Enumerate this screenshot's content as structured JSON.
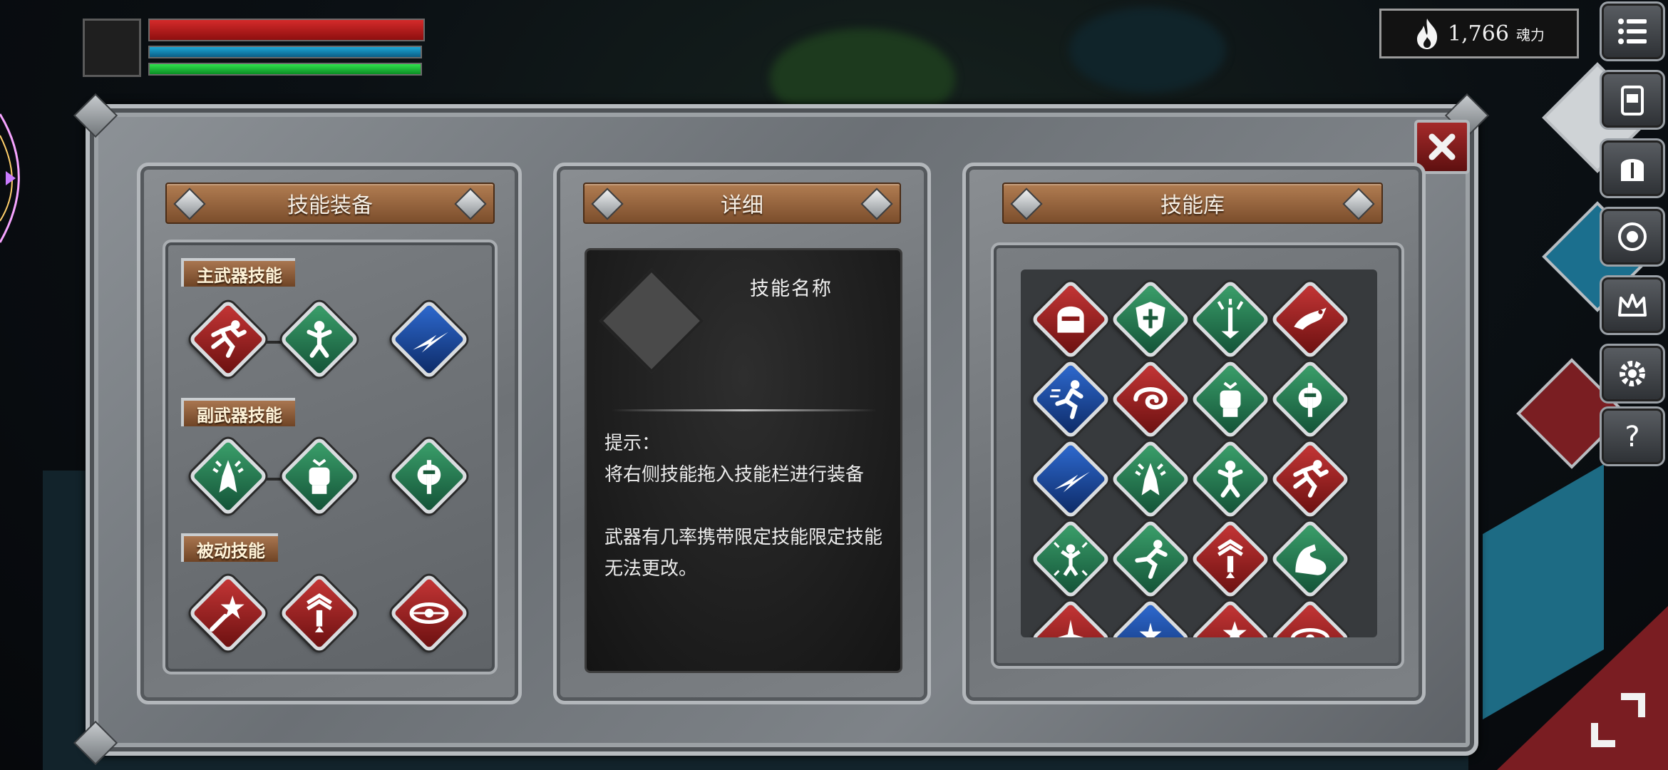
{
  "hud": {
    "hp_fraction": 1.0,
    "mp_fraction": 1.0,
    "stamina_fraction": 1.0,
    "souls_value": "1,766",
    "souls_unit": "魂力"
  },
  "panels": {
    "equip_title": "技能装备",
    "detail_title": "详细",
    "library_title": "技能库"
  },
  "equip": {
    "main_label": "主武器技能",
    "sub_label": "副武器技能",
    "passive_label": "被动技能",
    "main_skills": [
      {
        "color": "red",
        "icon": "dash-runner-icon"
      },
      {
        "color": "green",
        "icon": "fighter-stance-icon"
      },
      {
        "color": "blue",
        "icon": "lightning-slash-icon"
      }
    ],
    "sub_skills": [
      {
        "color": "green",
        "icon": "praying-hands-icon"
      },
      {
        "color": "green",
        "icon": "fist-icon"
      },
      {
        "color": "green",
        "icon": "holy-axe-icon"
      }
    ],
    "passive_skills": [
      {
        "color": "red",
        "icon": "star-sword-icon"
      },
      {
        "color": "red",
        "icon": "rank-sword-icon"
      },
      {
        "color": "red",
        "icon": "eye-dagger-icon"
      }
    ]
  },
  "detail": {
    "skill_name": "技能名称",
    "hint_title": "提示：",
    "hint_line1": "将右侧技能拖入技能栏进行装备",
    "hint_line2": "武器有几率携带限定技能限定技能无法更改。"
  },
  "library": {
    "skills": [
      {
        "color": "red",
        "icon": "helmet-icon"
      },
      {
        "color": "green",
        "icon": "shield-cross-icon"
      },
      {
        "color": "green",
        "icon": "sword-burst-icon"
      },
      {
        "color": "red",
        "icon": "dragon-icon"
      },
      {
        "color": "blue",
        "icon": "sprint-icon"
      },
      {
        "color": "red",
        "icon": "swirl-icon"
      },
      {
        "color": "green",
        "icon": "fist-icon"
      },
      {
        "color": "green",
        "icon": "holy-axe-icon"
      },
      {
        "color": "blue",
        "icon": "lightning-slash-icon"
      },
      {
        "color": "green",
        "icon": "praying-hands-icon"
      },
      {
        "color": "green",
        "icon": "fighter-stance-icon"
      },
      {
        "color": "red",
        "icon": "dash-runner-icon"
      },
      {
        "color": "green",
        "icon": "burst-figure-icon"
      },
      {
        "color": "green",
        "icon": "runner-icon"
      },
      {
        "color": "red",
        "icon": "rank-sword-icon"
      },
      {
        "color": "green",
        "icon": "flex-arm-icon"
      },
      {
        "color": "red",
        "icon": "spark-icon"
      },
      {
        "color": "blue",
        "icon": "star-cluster-icon"
      },
      {
        "color": "red",
        "icon": "star-sword-icon"
      },
      {
        "color": "red",
        "icon": "eye-dagger-icon"
      }
    ]
  },
  "colors": {
    "red": "#c53636",
    "green": "#3ba06b",
    "blue": "#2e6ad0",
    "plank": "#a97650"
  }
}
